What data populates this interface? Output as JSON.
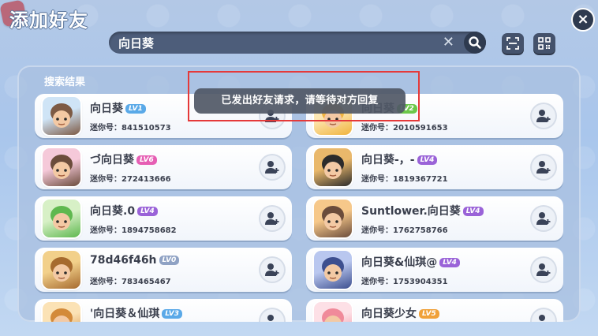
{
  "header": {
    "title": "添加好友",
    "close_icon": "close-icon"
  },
  "search": {
    "value": "向日葵",
    "clear_icon": "clear-icon",
    "search_icon": "search-icon"
  },
  "top_actions": [
    {
      "icon": "scan-icon"
    },
    {
      "icon": "qr-code-icon"
    }
  ],
  "results": {
    "title": "搜索结果",
    "id_label": "迷你号：",
    "items": [
      {
        "name": "向日葵",
        "lv": "LV1",
        "lv_color": "#5aa9e8",
        "mini_id": "841510573"
      },
      {
        "name": "向日葵",
        "lv": "LV2",
        "lv_color": "#6cc84a",
        "mini_id": "2010591653"
      },
      {
        "name": "づ向日葵",
        "lv": "LV6",
        "lv_color": "#e65fb4",
        "mini_id": "272413666"
      },
      {
        "name": "向日葵-，-",
        "lv": "LV4",
        "lv_color": "#9a63d8",
        "mini_id": "1819367721"
      },
      {
        "name": "向日葵.0",
        "lv": "LV4",
        "lv_color": "#9a63d8",
        "mini_id": "1894758682"
      },
      {
        "name": "Suntlower.向日葵",
        "lv": "LV4",
        "lv_color": "#9a63d8",
        "mini_id": "1762758766"
      },
      {
        "name": "78d46f46h",
        "lv": "LV0",
        "lv_color": "#8fa2c4",
        "mini_id": "783465467"
      },
      {
        "name": "向日葵&仙琪@",
        "lv": "LV4",
        "lv_color": "#9a63d8",
        "mini_id": "1753904351"
      },
      {
        "name": "'向日葵＆仙琪",
        "lv": "LV3",
        "lv_color": "#5aa9e8",
        "mini_id": ""
      },
      {
        "name": "向日葵少女",
        "lv": "LV5",
        "lv_color": "#f0a13a",
        "mini_id": ""
      }
    ]
  },
  "toast": {
    "message": "已发出好友请求，请等待对方回复"
  },
  "colors": {
    "accent_dark": "#2e3a4f",
    "toast_highlight": "#e53939"
  }
}
